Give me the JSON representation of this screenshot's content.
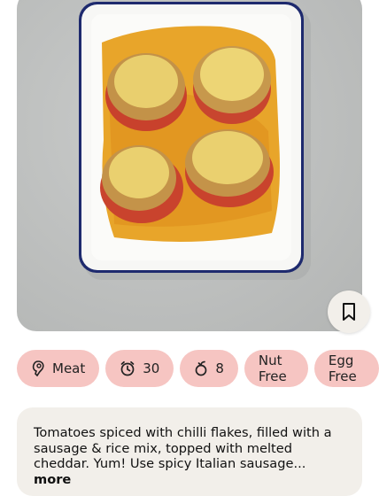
{
  "recipe": {
    "image_alt": "Stuffed tomatoes with sausage and rice topped with melted cheddar in a baking dish",
    "tags": [
      {
        "icon": "meat-icon",
        "label": "Meat"
      },
      {
        "icon": "clock-icon",
        "label": "30"
      },
      {
        "icon": "ingredients-icon",
        "label": "8"
      },
      {
        "icon": "",
        "label": "Nut Free"
      },
      {
        "icon": "",
        "label": "Egg Free"
      }
    ],
    "description": "Tomatoes spiced with chilli flakes, filled with a sausage & rice mix, topped with melted cheddar. Yum! Use spicy Italian sausage...",
    "more_label": "more"
  },
  "colors": {
    "tag_bg": "#f6c5c2",
    "card_bg": "#f2efea"
  }
}
